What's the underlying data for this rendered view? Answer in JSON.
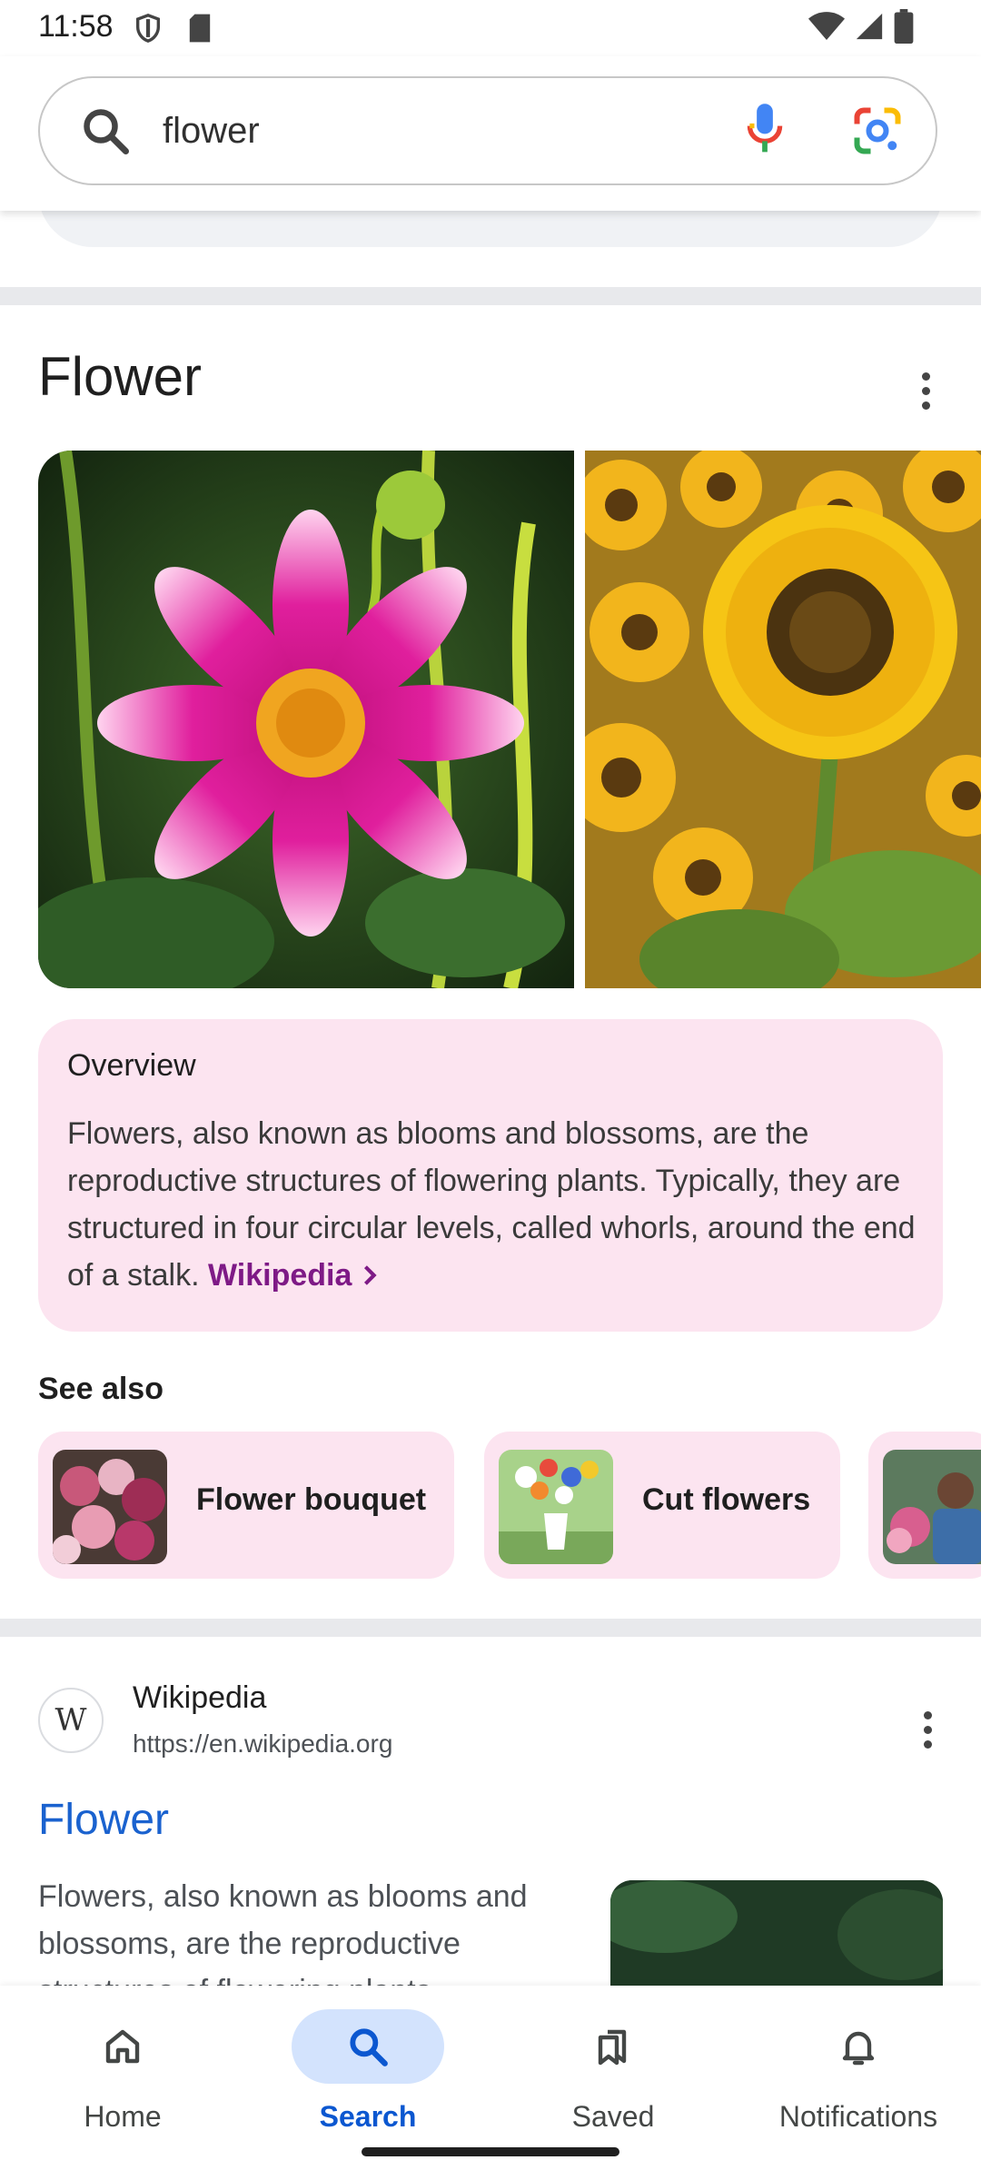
{
  "status_bar": {
    "time": "11:58"
  },
  "search": {
    "query": "flower"
  },
  "knowledge_panel": {
    "title": "Flower",
    "overview": {
      "heading": "Overview",
      "text": "Flowers, also known as blooms and blossoms, are the reproductive structures of flowering plants. Typically, they are structured in four circular levels, called whorls, around the end of a stalk.",
      "source_link": "Wikipedia"
    },
    "see_also": {
      "heading": "See also",
      "items": [
        {
          "label": "Flower bouquet"
        },
        {
          "label": "Cut flowers"
        }
      ]
    }
  },
  "result": {
    "site_name": "Wikipedia",
    "favicon_letter": "W",
    "url": "https://en.wikipedia.org",
    "title": "Flower",
    "snippet": "Flowers, also known as blooms and blossoms, are the reproductive structures of flowering plants..."
  },
  "bottom_nav": {
    "items": [
      {
        "label": "Home",
        "icon": "home-icon"
      },
      {
        "label": "Search",
        "icon": "search-icon",
        "active": true
      },
      {
        "label": "Saved",
        "icon": "saved-icon"
      },
      {
        "label": "Notifications",
        "icon": "bell-icon"
      }
    ]
  },
  "colors": {
    "accent": "#0b57d0",
    "link_title": "#1a62cf",
    "card_pink": "#fce4f0",
    "wiki_link": "#7e1a86"
  }
}
